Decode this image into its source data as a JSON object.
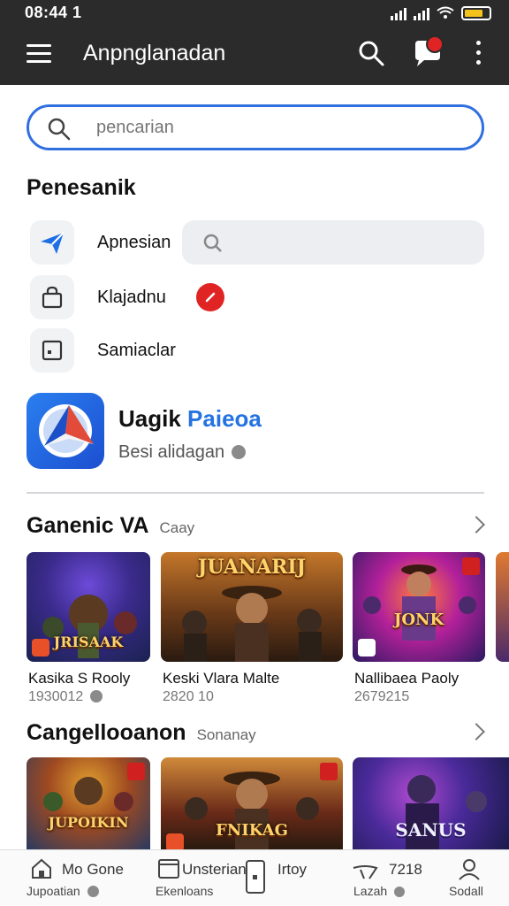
{
  "status": {
    "time": "08:44 1"
  },
  "header": {
    "title": "Anpnglanadan"
  },
  "search": {
    "placeholder": "pencarian"
  },
  "section": {
    "title": "Penesanik"
  },
  "menu": [
    {
      "label": "Apnesian",
      "icon": "send-arrow-icon"
    },
    {
      "label": "Klajadnu",
      "icon": "bag-icon"
    },
    {
      "label": "Samiaclar",
      "icon": "square-icon"
    }
  ],
  "featured": {
    "name_part1": "Uagik",
    "name_part2": "Paieoa",
    "subtitle": "Besi alidagan"
  },
  "rows": [
    {
      "title": "Ganenic VA",
      "subtitle": "Caay",
      "tiles": [
        {
          "name": "Kasika S Rooly",
          "meta": "1930012",
          "art_text": "JRISAAK"
        },
        {
          "name": "Keski Vlara Malte",
          "meta": "2820 10",
          "art_text": "JUANARIJ"
        },
        {
          "name": "Nallibaea Paoly",
          "meta": "2679215",
          "art_text": "JONK"
        }
      ]
    },
    {
      "title": "Cangellooanon",
      "subtitle": "Sonanay",
      "tiles": [
        {
          "art_text": "JUPOIKIN"
        },
        {
          "art_text": "FNIKAG"
        },
        {
          "art_text": "SANUS"
        }
      ]
    }
  ],
  "bottom_nav": [
    {
      "line1": "Mo Gone",
      "line2": "Jupoatian",
      "icon": "home-icon"
    },
    {
      "line1": "Unsterian",
      "line2": "Ekenloans",
      "icon": "tablet-icon"
    },
    {
      "line1": "Irtoy",
      "line2": "",
      "icon": "phone-icon"
    },
    {
      "line1": "7218",
      "line2": "Lazah",
      "icon": "plane-icon"
    },
    {
      "line1": "",
      "line2": "Sodall",
      "icon": "profile-icon"
    }
  ],
  "colors": {
    "accent": "#2f6fe0",
    "topbar": "#2b2b2b",
    "badge_red": "#e02424"
  }
}
